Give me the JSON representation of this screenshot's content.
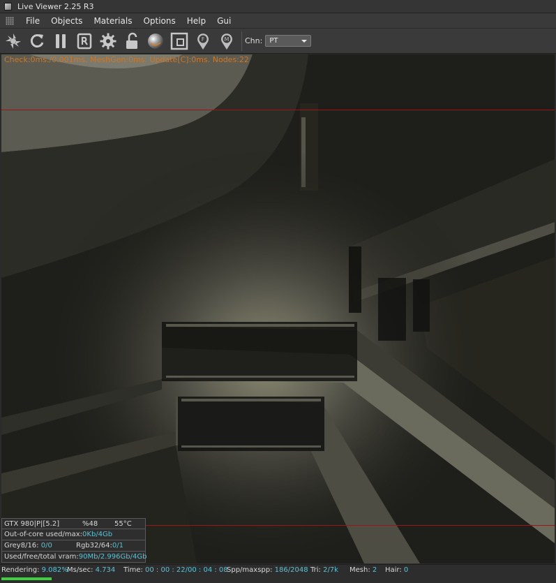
{
  "window": {
    "title": "Live Viewer 2.25 R3"
  },
  "menu": {
    "items": [
      "File",
      "Objects",
      "Materials",
      "Options",
      "Help",
      "Gui"
    ]
  },
  "toolbar": {
    "tools": [
      "aperture-icon",
      "refresh-icon",
      "pause-icon",
      "r-letter-icon",
      "gear-icon",
      "unlock-icon",
      "sphere-icon",
      "region-icon",
      "pin-f-icon",
      "pin-m-icon"
    ],
    "chn_label": "Chn:",
    "chn_value": "PT"
  },
  "viewport": {
    "stats": "Check:0ms./0.001ms. MeshGen:0ms. Update[C]:0ms. Nodes:22",
    "stats_color": "#d2761f",
    "guide_color": "#a01414"
  },
  "info": {
    "gpu": "GTX 980|P|[5.2]",
    "gpu_load": "%48",
    "gpu_temp": "55°C",
    "ooc_label": "Out-of-core used/max:",
    "ooc_value": "0Kb/4Gb",
    "grey_label": "Grey8/16: ",
    "grey_value": "0/0",
    "rgb_label": "Rgb32/64: ",
    "rgb_value": "0/1",
    "vram_label": "Used/free/total vram: ",
    "vram_value": "90Mb/2.996Gb/4Gb",
    "value_color": "#59c3d6"
  },
  "status": {
    "rendering_label": "Rendering: ",
    "rendering_value": "9.082%",
    "progress": 0.65,
    "ms_label": "Ms/sec: ",
    "ms_value": "4.734",
    "time_label": "Time: ",
    "time_value": "00 : 00 : 22/00 : 04 : 08",
    "spp_label": "Spp/maxspp: ",
    "spp_value": "186/2048",
    "tri_label": "Tri: ",
    "tri_value": "2/7k",
    "mesh_label": "Mesh: ",
    "mesh_value": "2",
    "hair_label": "Hair: ",
    "hair_value": "0",
    "progress_color": "#3fd03f"
  }
}
